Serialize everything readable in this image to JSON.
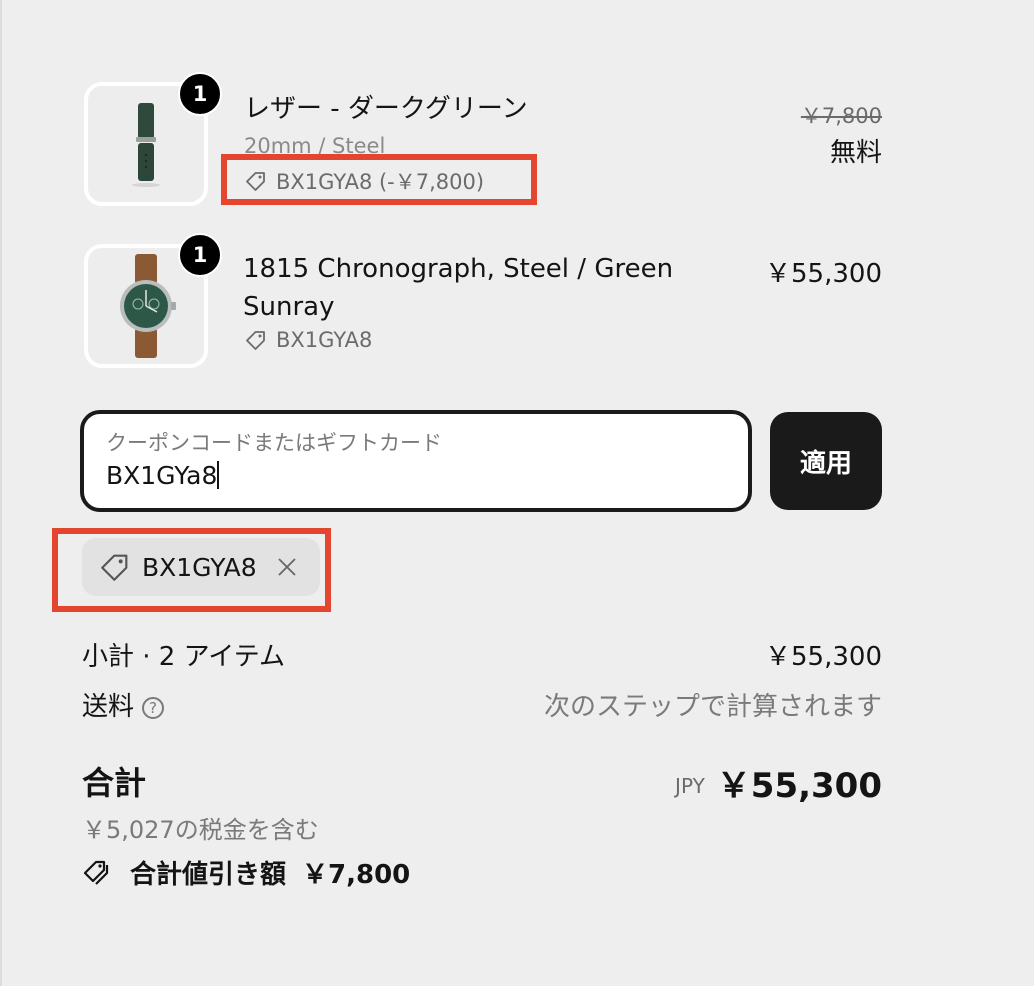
{
  "line_items": [
    {
      "quantity": "1",
      "name": "レザー - ダークグリーン",
      "variant": "20mm / Steel",
      "discount_code": "BX1GYA8 (-￥7,800)",
      "original_price": "￥7,800",
      "price": "無料"
    },
    {
      "quantity": "1",
      "name_line1": "1815 Chronograph, Steel / Green",
      "name_line2": "Sunray",
      "discount_code": "BX1GYA8",
      "price": "￥55,300"
    }
  ],
  "coupon": {
    "label": "クーポンコードまたはギフトカード",
    "value": "BX1GYa8",
    "apply_label": "適用"
  },
  "applied_code": {
    "label": "BX1GYA8"
  },
  "summary": {
    "subtotal_label": "小計 · 2 アイテム",
    "subtotal_value": "￥55,300",
    "shipping_label": "送料",
    "shipping_value": "次のステップで計算されます",
    "help_glyph": "?",
    "total_label": "合計",
    "currency": "JPY",
    "total_value": "￥55,300",
    "tax_note": "￥5,027の税金を含む",
    "discount_label": "合計値引き額",
    "discount_value": "￥7,800"
  },
  "colors": {
    "background": "#eeeeee",
    "highlight": "#e3452f",
    "button": "#1a1a1a"
  }
}
